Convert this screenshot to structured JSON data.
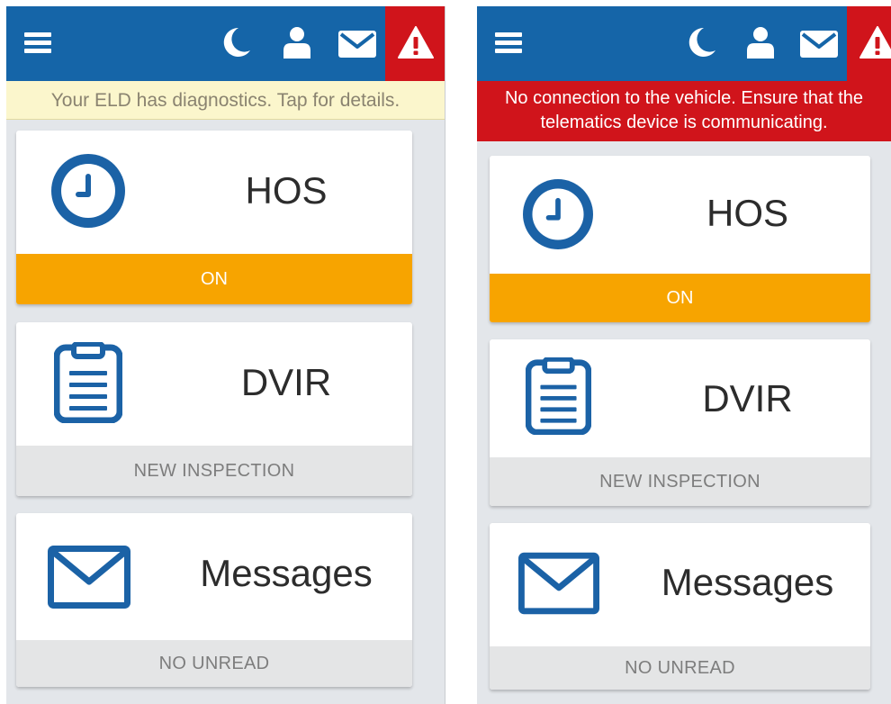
{
  "screens": [
    {
      "banner": "Your ELD has diagnostics. Tap for details.",
      "cards": {
        "hos": {
          "title": "HOS",
          "status": "ON"
        },
        "dvir": {
          "title": "DVIR",
          "status": "NEW INSPECTION"
        },
        "messages": {
          "title": "Messages",
          "status": "NO UNREAD"
        }
      }
    },
    {
      "banner_line1": "No connection to the vehicle. Ensure that the",
      "banner_line2": "telematics device is communicating.",
      "cards": {
        "hos": {
          "title": "HOS",
          "status": "ON"
        },
        "dvir": {
          "title": "DVIR",
          "status": "NEW INSPECTION"
        },
        "messages": {
          "title": "Messages",
          "status": "NO UNREAD"
        }
      }
    }
  ],
  "icons": {
    "menu": "menu-icon",
    "theme": "moon-icon",
    "user": "user-icon",
    "mail": "mail-icon",
    "alert": "warning-icon",
    "hos": "clock-icon",
    "dvir": "clipboard-icon",
    "messages": "envelope-icon"
  },
  "colors": {
    "header": "#1565a8",
    "alert": "#d0141b",
    "status_on": "#f7a400",
    "diagnostic_banner": "#fbf6cc",
    "icon_blue": "#1b62a6"
  }
}
